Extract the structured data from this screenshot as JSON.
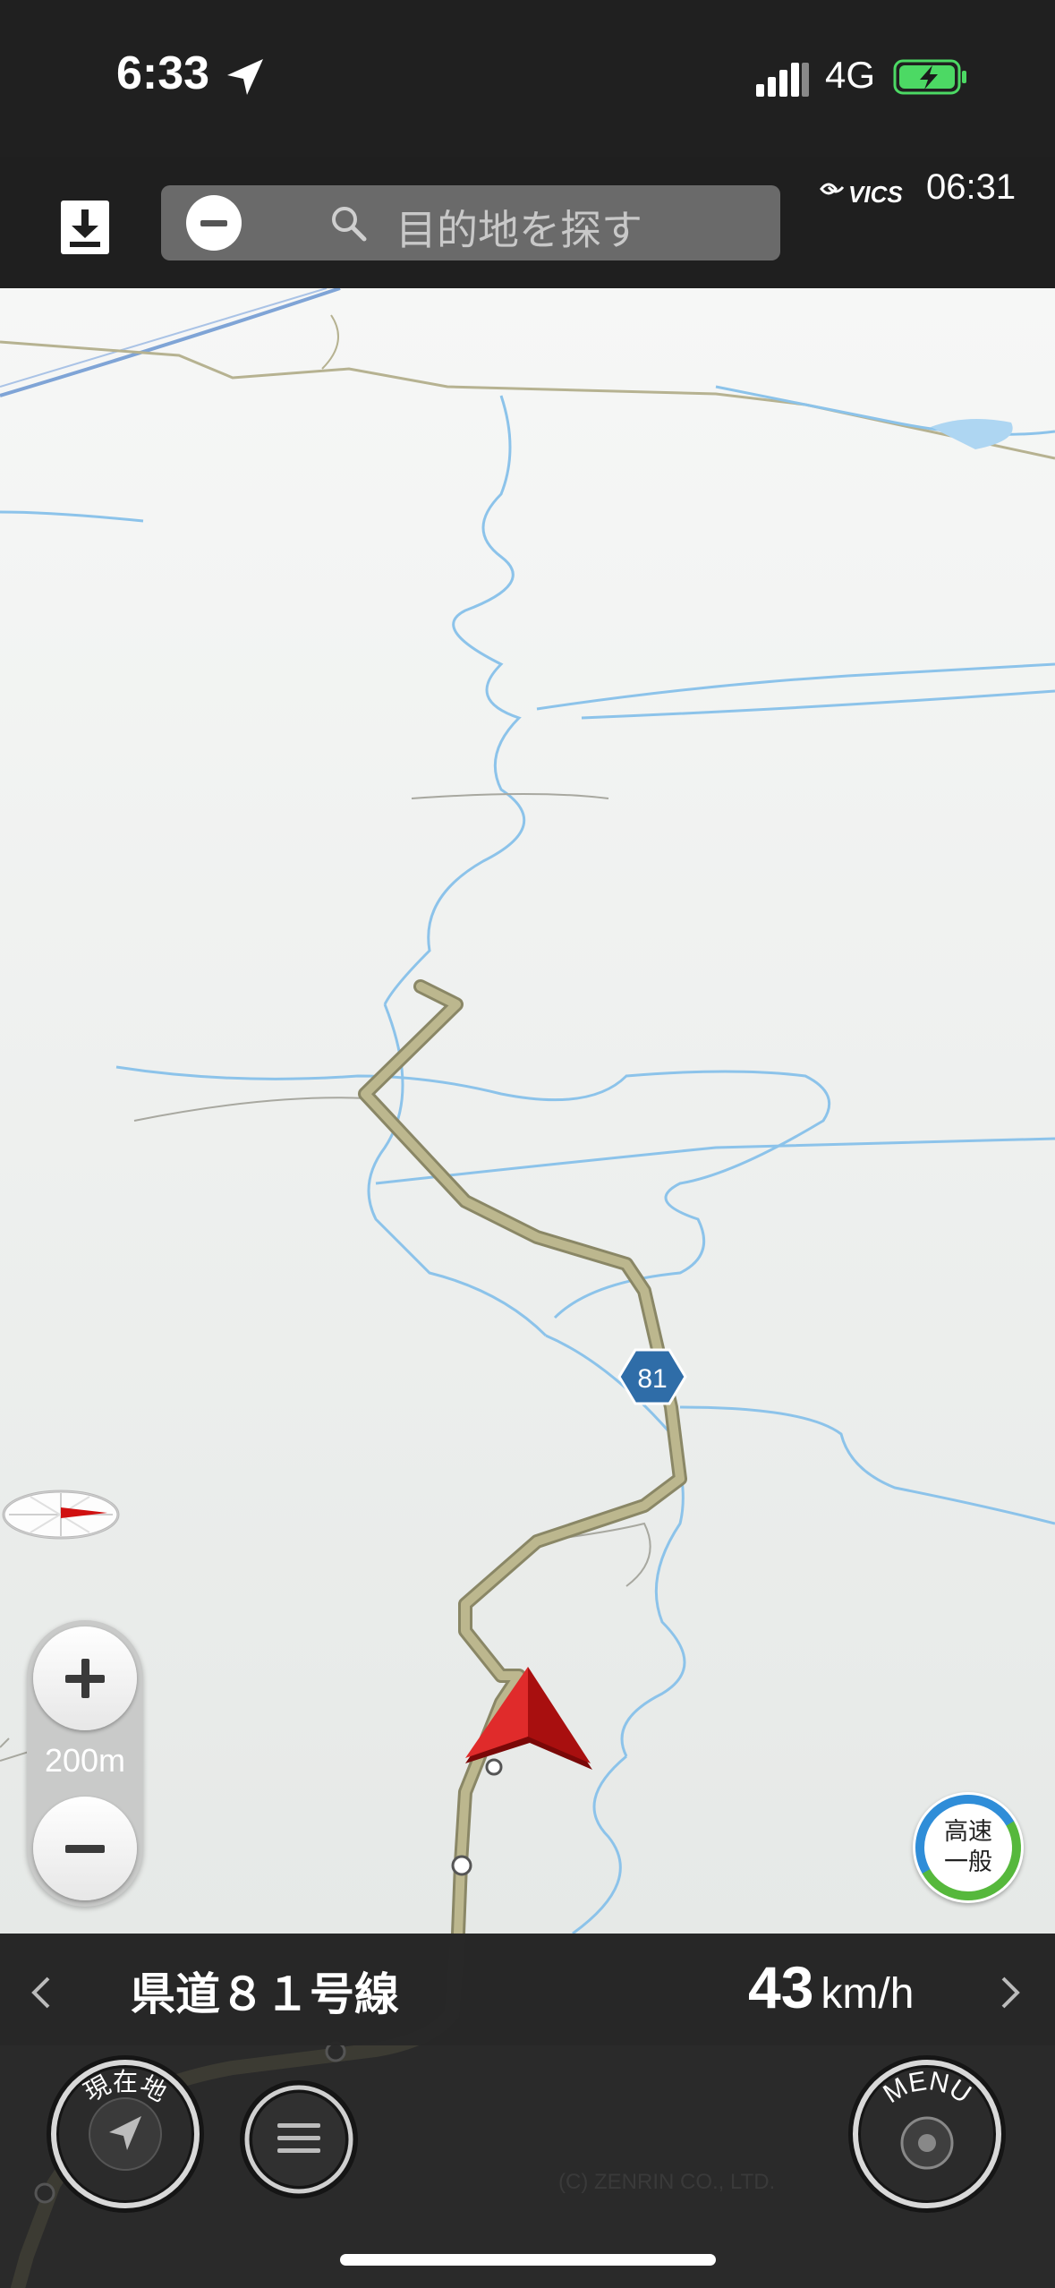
{
  "status_bar": {
    "time": "6:33",
    "network": "4G",
    "icons": [
      "location-arrow-icon",
      "signal-bars-icon",
      "battery-charging-icon"
    ],
    "battery_color": "#4cd964"
  },
  "top_bar": {
    "search_placeholder": "目的地を探す",
    "vics_label": "VICS",
    "vics_time": "06:31"
  },
  "map": {
    "route_number": "81",
    "scale_label": "200m",
    "road_color": "#b9b38a",
    "water_color": "#8cc3ea",
    "route_shield_color": "#2f6da8",
    "vehicle_marker_color": "#d01010"
  },
  "highway_toggle": {
    "line1": "高速",
    "line2": "一般"
  },
  "bottom": {
    "road_name": "県道８１号線",
    "speed_value": "43",
    "speed_unit": "km/h",
    "current_location_label": "現在地",
    "menu_label": "MENU",
    "copyright": "(C) ZENRIN CO., LTD."
  }
}
